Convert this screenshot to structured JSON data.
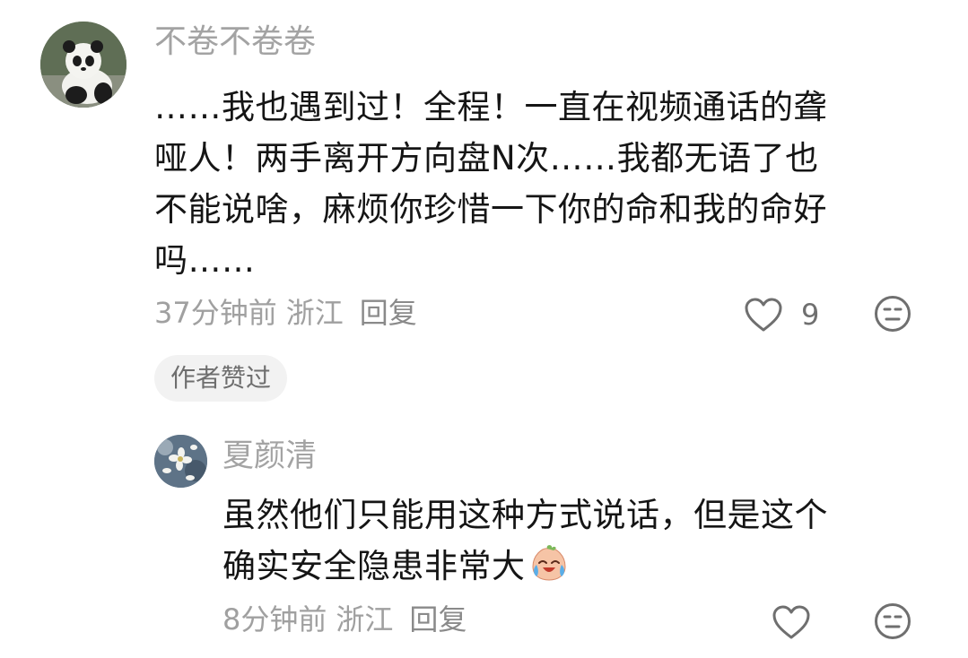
{
  "comment": {
    "username": "不卷不卷卷",
    "avatar_icon": "panda-avatar",
    "lines": [
      "……我也遇到过！全程！一直在视频通话的聋",
      "哑人！两手离开方向盘N次……我都无语了也",
      "不能说啥，麻烦你珍惜一下你的命和我的命好",
      "吗……"
    ],
    "time": "37分钟前",
    "location": "浙江",
    "reply_label": "回复",
    "like_count": "9",
    "badge": "作者赞过"
  },
  "reply": {
    "username": "夏颜清",
    "avatar_icon": "flowers-avatar",
    "lines": [
      "虽然他们只能用这种方式说话，但是这个",
      "确实安全隐患非常大"
    ],
    "emoji_icon": "crying-laughing-peach-emoji",
    "time": "8分钟前",
    "location": "浙江",
    "reply_label": "回复"
  },
  "colors": {
    "username": "#a3a3a3",
    "body_text": "#151515",
    "meta": "#a0a0a0",
    "badge_bg": "#f2f2f2",
    "icon": "#6f6f6f"
  }
}
